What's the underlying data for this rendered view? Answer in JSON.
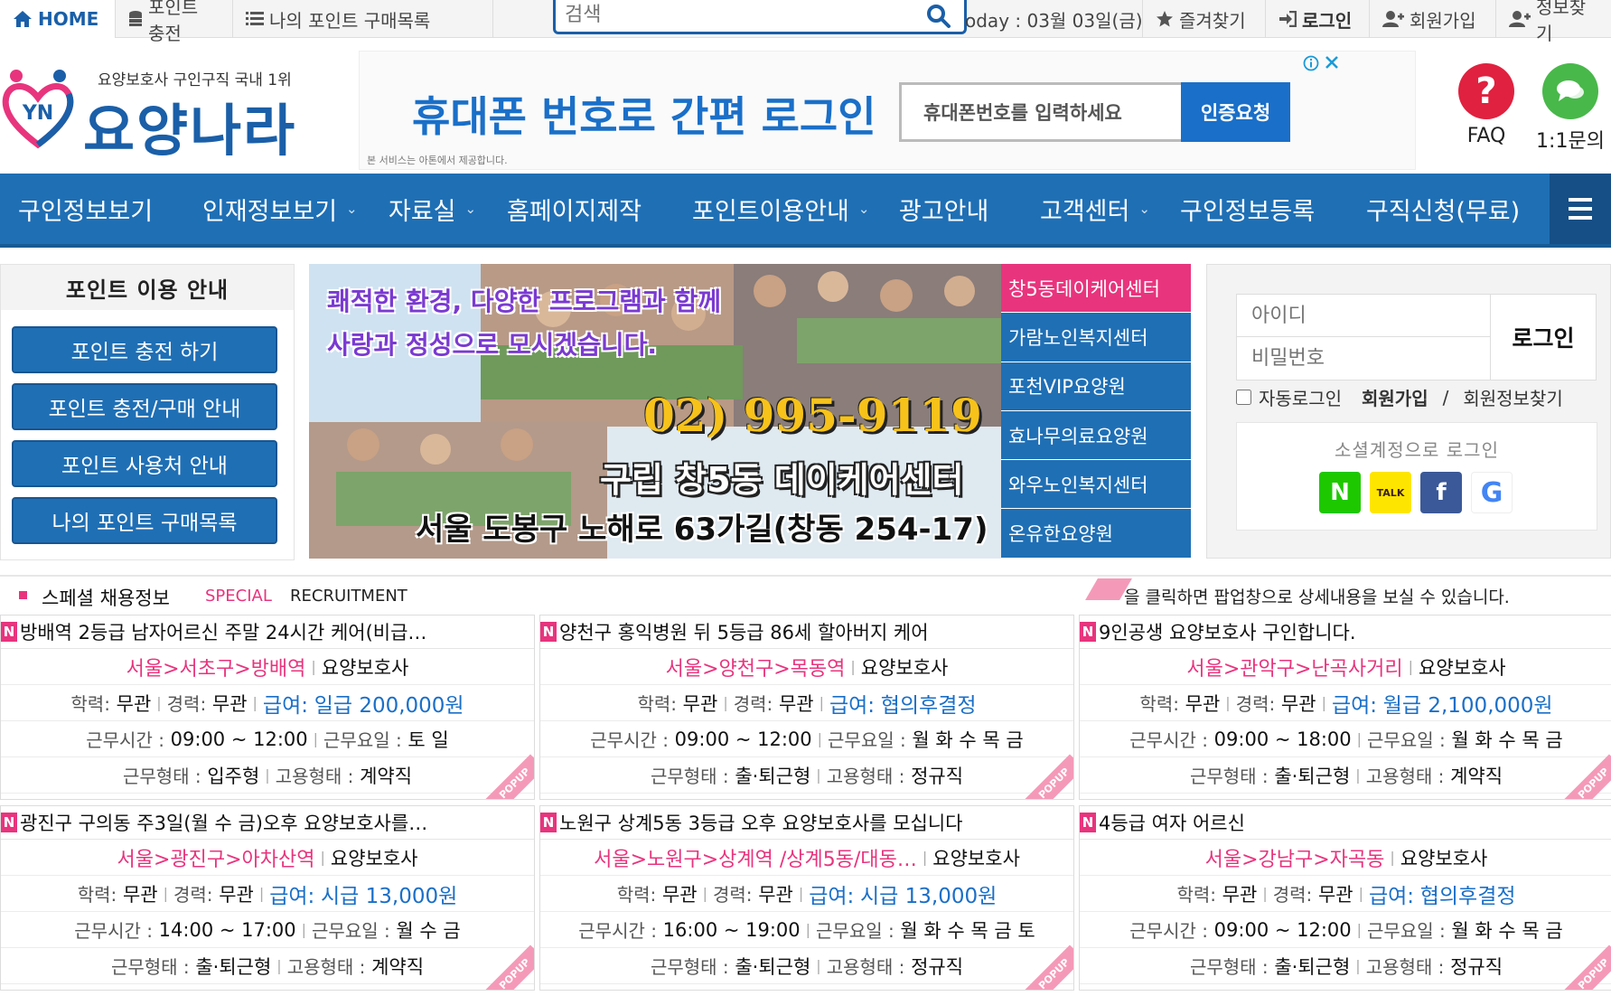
{
  "topbar": {
    "home": "HOME",
    "point_charge": "포인트 충전",
    "my_points": "나의 포인트 구매목록",
    "search_placeholder": "검색",
    "today": "oday : 03월 03일(금)",
    "favorites": "즐겨찾기",
    "login": "로그인",
    "signup": "회원가입",
    "find_info": "정보찾기"
  },
  "header": {
    "logo_tagline": "요양보호사 구인구직 국내 1위",
    "logo_name": "요양나라",
    "logo_mark": "YN",
    "ad_headline": "휴대폰 번호로 간편 로그인",
    "ad_input_placeholder": "휴대폰번호를 입력하세요",
    "ad_button": "인증요청",
    "ad_disclaimer": "본 서비스는 아톤에서 제공합니다.",
    "faq": "FAQ",
    "inquiry": "1:1문의"
  },
  "nav": [
    {
      "label": "구인정보보기",
      "caret": false
    },
    {
      "label": "인재정보보기",
      "caret": true
    },
    {
      "label": "자료실",
      "caret": true
    },
    {
      "label": "홈페이지제작",
      "caret": false
    },
    {
      "label": "포인트이용안내",
      "caret": true
    },
    {
      "label": "광고안내",
      "caret": false
    },
    {
      "label": "고객센터",
      "caret": true
    },
    {
      "label": "구인정보등록",
      "caret": false
    },
    {
      "label": "구직신청(무료)",
      "caret": false
    }
  ],
  "sidebar": {
    "title": "포인트 이용 안내",
    "buttons": [
      "포인트 충전 하기",
      "포인트 충전/구매 안내",
      "포인트 사용처 안내",
      "나의 포인트 구매목록"
    ]
  },
  "banner": {
    "slogan_1": "쾌적한 환경, 다양한 프로그램과 함께",
    "slogan_2": "사랑과 정성으로 모시겠습니다.",
    "phone": "02) 995-9119",
    "center_name": "구립 창5동 데이케어센터",
    "address": "서울 도봉구 노해로 63가길(창동 254-17)"
  },
  "centers": [
    "창5동데이케어센터",
    "가람노인복지센터",
    "포천VIP요양원",
    "효나무의료요양원",
    "와우노인복지센터",
    "온유한요양원"
  ],
  "login": {
    "id_placeholder": "아이디",
    "pw_placeholder": "비밀번호",
    "button": "로그인",
    "auto_login": "자동로그인",
    "signup": "회원가입",
    "slash": "/",
    "find": "회원정보찾기",
    "social_caption": "소셜계정으로 로그인",
    "social": [
      "N",
      "TALK",
      "f",
      "G"
    ]
  },
  "special": {
    "title_ko": "스페셜 채용정보",
    "title_en_1": "SPECIAL",
    "title_en_2": "RECRUITMENT",
    "note": "을 클릭하면 팝업창으로 상세내용을 보실 수 있습니다."
  },
  "labels": {
    "edu": "학력:",
    "exp": "경력:",
    "pay": "급여:",
    "hours": "근무시간 :",
    "days": "근무요일 :",
    "work_type": "근무형태 :",
    "emp_type": "고용형태 :",
    "new_badge": "N",
    "popup": "POPUP",
    "sep": "|"
  },
  "jobs": [
    {
      "title": "방배역 2등급 남자어르신 주말 24시간 케어(비급…",
      "location": "서울>서초구>방배역",
      "role": "요양보호사",
      "edu": "무관",
      "exp": "무관",
      "pay": "일급 200,000원",
      "hours": "09:00 ~ 12:00",
      "days": "토 일",
      "work_type": "입주형",
      "emp_type": "계약직"
    },
    {
      "title": "양천구 홍익병원 뒤 5등급 86세 할아버지 케어",
      "location": "서울>양천구>목동역",
      "role": "요양보호사",
      "edu": "무관",
      "exp": "무관",
      "pay": "협의후결정",
      "hours": "09:00 ~ 12:00",
      "days": "월 화 수 목 금",
      "work_type": "출·퇴근형",
      "emp_type": "정규직"
    },
    {
      "title": "9인공생 요양보호사 구인합니다.",
      "location": "서울>관악구>난곡사거리",
      "role": "요양보호사",
      "edu": "무관",
      "exp": "무관",
      "pay": "월급 2,100,000원",
      "hours": "09:00 ~ 18:00",
      "days": "월 화 수 목 금",
      "work_type": "출·퇴근형",
      "emp_type": "계약직"
    },
    {
      "title": "광진구 구의동 주3일(월 수 금)오후 요양보호사를…",
      "location": "서울>광진구>아차산역",
      "role": "요양보호사",
      "edu": "무관",
      "exp": "무관",
      "pay": "시급 13,000원",
      "hours": "14:00 ~ 17:00",
      "days": "월 수 금",
      "work_type": "출·퇴근형",
      "emp_type": "계약직"
    },
    {
      "title": "노원구 상계5동 3등급 오후 요양보호사를 모십니다",
      "location": "서울>노원구>상계역 /상계5동/대동…",
      "role": "요양보호사",
      "edu": "무관",
      "exp": "무관",
      "pay": "시급 13,000원",
      "hours": "16:00 ~ 19:00",
      "days": "월 화 수 목 금 토",
      "work_type": "출·퇴근형",
      "emp_type": "정규직"
    },
    {
      "title": "4등급 여자 어르신",
      "location": "서울>강남구>자곡동",
      "role": "요양보호사",
      "edu": "무관",
      "exp": "무관",
      "pay": "협의후결정",
      "hours": "09:00 ~ 12:00",
      "days": "월 화 수 목 금",
      "work_type": "출·퇴근형",
      "emp_type": "정규직"
    }
  ],
  "colors": {
    "primary": "#1f6fb5",
    "accent": "#e8347d",
    "pay": "#1a6fc8"
  }
}
